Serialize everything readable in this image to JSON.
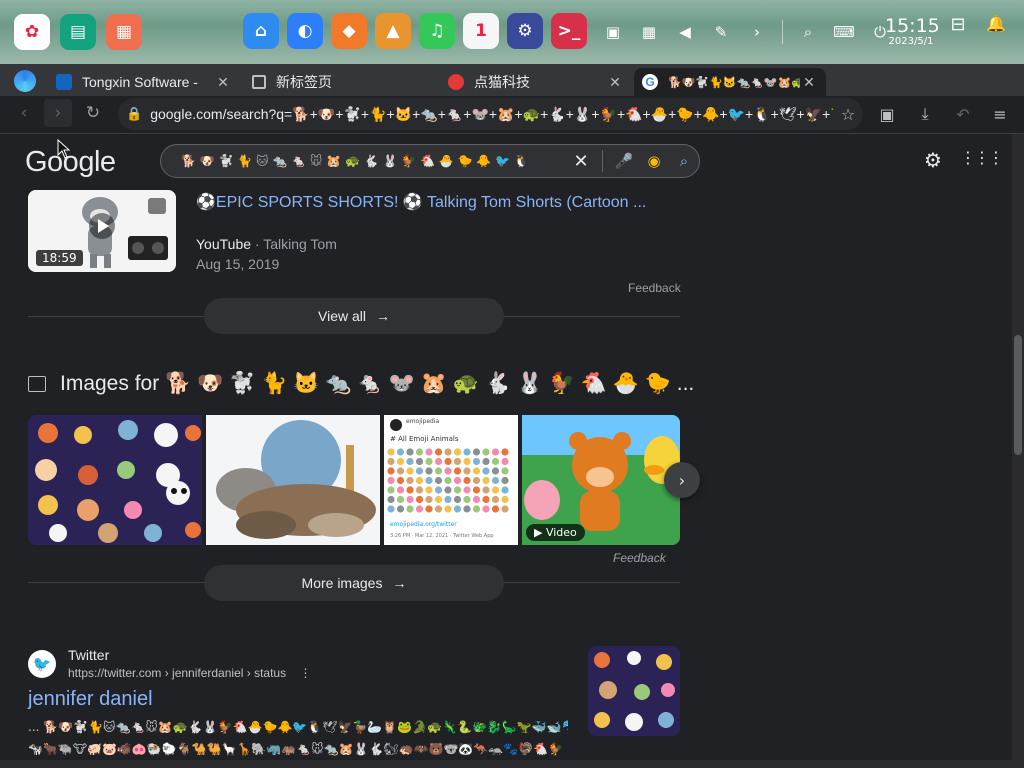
{
  "taskbar": {
    "apps_left": [
      {
        "name": "launcher-icon",
        "color": "#ffffff",
        "glyph": "✿"
      },
      {
        "name": "terminal-manager-icon",
        "color": "#14a37f",
        "glyph": "▤"
      },
      {
        "name": "app-store-icon",
        "color": "#ef6f4f",
        "glyph": "▦"
      }
    ],
    "apps_mid": [
      {
        "name": "file-manager-icon",
        "color": "#2e8bf0",
        "glyph": "⌂"
      },
      {
        "name": "browser-icon",
        "color": "#2d7ff9",
        "glyph": "◐"
      },
      {
        "name": "store-bag-icon",
        "color": "#f07a2a",
        "glyph": "◆"
      },
      {
        "name": "photos-icon",
        "color": "#e9952f",
        "glyph": "▲"
      },
      {
        "name": "music-icon",
        "color": "#34c759",
        "glyph": "♫"
      },
      {
        "name": "calendar-icon",
        "color": "#f6f6f6",
        "glyph": "1"
      },
      {
        "name": "settings-icon",
        "color": "#3a4a9a",
        "glyph": "⚙"
      },
      {
        "name": "terminal-icon",
        "color": "#d8304a",
        "glyph": ">_"
      }
    ],
    "tray": [
      "screenshot-icon",
      "keyboard-icon",
      "volume-icon",
      "pen-icon",
      "chevron-right-icon",
      "search-icon",
      "ime-icon",
      "power-icon"
    ],
    "tray_glyphs": [
      "▣",
      "▦",
      "◀",
      "✎",
      "›",
      "⌕",
      "⌨",
      "⏻"
    ],
    "time": "15:15",
    "date": "2023/5/1",
    "trash_glyph": "⊟",
    "bell_glyph": "🔔"
  },
  "tabs": [
    {
      "title": "Tongxin Software -",
      "fav_color": "#1565c0"
    },
    {
      "title": "新标签页",
      "fav_color": "#5f6368"
    },
    {
      "title": "点猫科技",
      "fav_color": "#e53935"
    },
    {
      "title": "🐕🐶🐩🐈🐱🐀🐁🐭🐹🐢🐇🐰🐓🐔🐣🐤🐥",
      "fav_color": "#ffffff"
    }
  ],
  "toolbar": {
    "url": "google.com/search?q=🐕+🐶+🐩+🐈+🐱+🐀+🐁+🐭+🐹+🐢+🐇+🐰+🐓+🐔+🐣+🐤+🐥+🐦+🐧+🕊+🦅+🦆+🦢+🦉+🐸+🐊+🐢+🦎+🐍+🐲+🐉+🦕+🦖+🐳...",
    "star": "☆"
  },
  "google": {
    "logo": "Google",
    "query": "🐕 🐶 🐩 🐈 🐱 🐀 🐁 🐭 🐹 🐢 🐇 🐰 🐓 🐔 🐣 🐤 🐥 🐦 🐧"
  },
  "video": {
    "duration": "18:59",
    "title": "⚽️EPIC SPORTS SHORTS! ⚽️ Talking Tom Shorts (Cartoon ...",
    "source": "YouTube",
    "channel": "Talking Tom",
    "sep": " · ",
    "date": "Aug 15, 2019"
  },
  "feedback": "Feedback",
  "view_all": "View all",
  "images": {
    "heading": "Images for 🐕 🐶 🐩 🐈 🐱 🐀 🐁 🐭 🐹 🐢 🐇 🐰 🐓 🐔 🐣 🐤 ...",
    "video_badge": "▶ Video",
    "tweet_caption": "# All Emoji Animals",
    "tweet_link": "emojipedia.org/twitter",
    "tweet_handle": "emojipedia",
    "tweet_footer": "3:26 PM · Mar 12, 2021 · Twitter Web App",
    "more": "More images"
  },
  "result": {
    "site": "Twitter",
    "url": "https://twitter.com › jenniferdaniel › status",
    "title": "jennifer daniel",
    "snippet1": "... 🐕🐶🐩🐈🐱🐀🐁🐭🐹🐢🐇🐰🐓🐔🐣🐤🐥🐦🐧🕊🦅🦆🦢🦉🐸🐊🐢🦎🐍🐲🐉🦕🦖🐳🐋🐬🐟🐠🐡🦈🐙🐚🐌🦋🐛🐜🐝🐞🦗🕷🕸🦂",
    "snippet2": "🐄🐂🐃🐮🐖🐷🐗🐽🐏🐑🐐🐪🐫🦙🦒🐘🦏🦛🐁🐭🐀🐹🐰🐇🐿🦔🦇🐻🐨🐼🦘🦡🐾🦃🐔🐓 ..."
  }
}
